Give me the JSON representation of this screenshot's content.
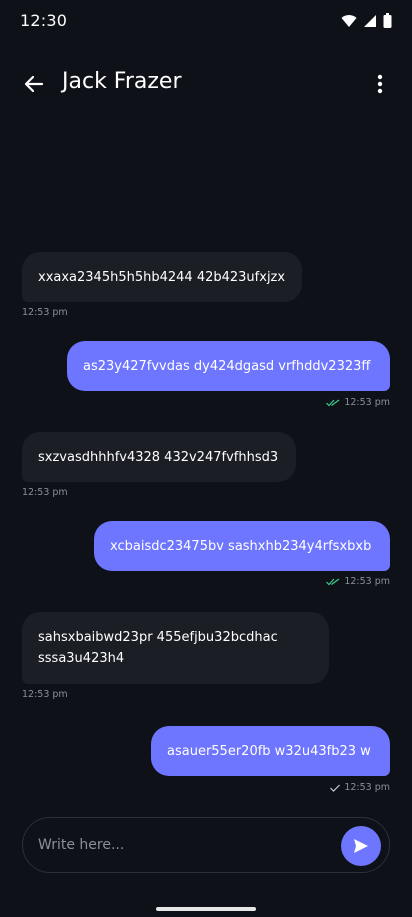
{
  "status_bar": {
    "time": "12:30",
    "icons": [
      "wifi-icon",
      "signal-icon",
      "battery-icon"
    ]
  },
  "header": {
    "back_icon": "arrow-left-icon",
    "contact_name": "Jack Frazer",
    "menu_icon": "more-vertical-icon"
  },
  "messages": [
    {
      "direction": "incoming",
      "text": "xxaxa2345h5h5hb4244 42b423ufxjzx",
      "time": "12:53 pm"
    },
    {
      "direction": "outgoing",
      "text": "as23y427fvvdas dy424dgasd vrfhddv2323ff",
      "time": "12:53 pm",
      "status": "read"
    },
    {
      "direction": "incoming",
      "text": "sxzvasdhhhfv4328 432v247fvfhhsd3",
      "time": "12:53 pm"
    },
    {
      "direction": "outgoing",
      "text": "xcbaisdc23475bv sashxhb234y4rfsxbxb",
      "time": "12:53 pm",
      "status": "read"
    },
    {
      "direction": "incoming",
      "text": "sahsxbaibwd23pr 455efjbu32bcdhac sssa3u423h4",
      "time": "12:53 pm"
    },
    {
      "direction": "outgoing",
      "text": "asauer55er20fb w32u43fb23 w",
      "time": "12:53 pm",
      "status": "sent"
    }
  ],
  "composer": {
    "placeholder": "Write here...",
    "value": "",
    "send_icon": "send-icon"
  },
  "colors": {
    "background": "#0e1117",
    "incoming_bubble": "#1b1e25",
    "outgoing_bubble": "#6e75ff",
    "read_tick": "#3ecf8e",
    "meta_text": "#8a8f99"
  }
}
